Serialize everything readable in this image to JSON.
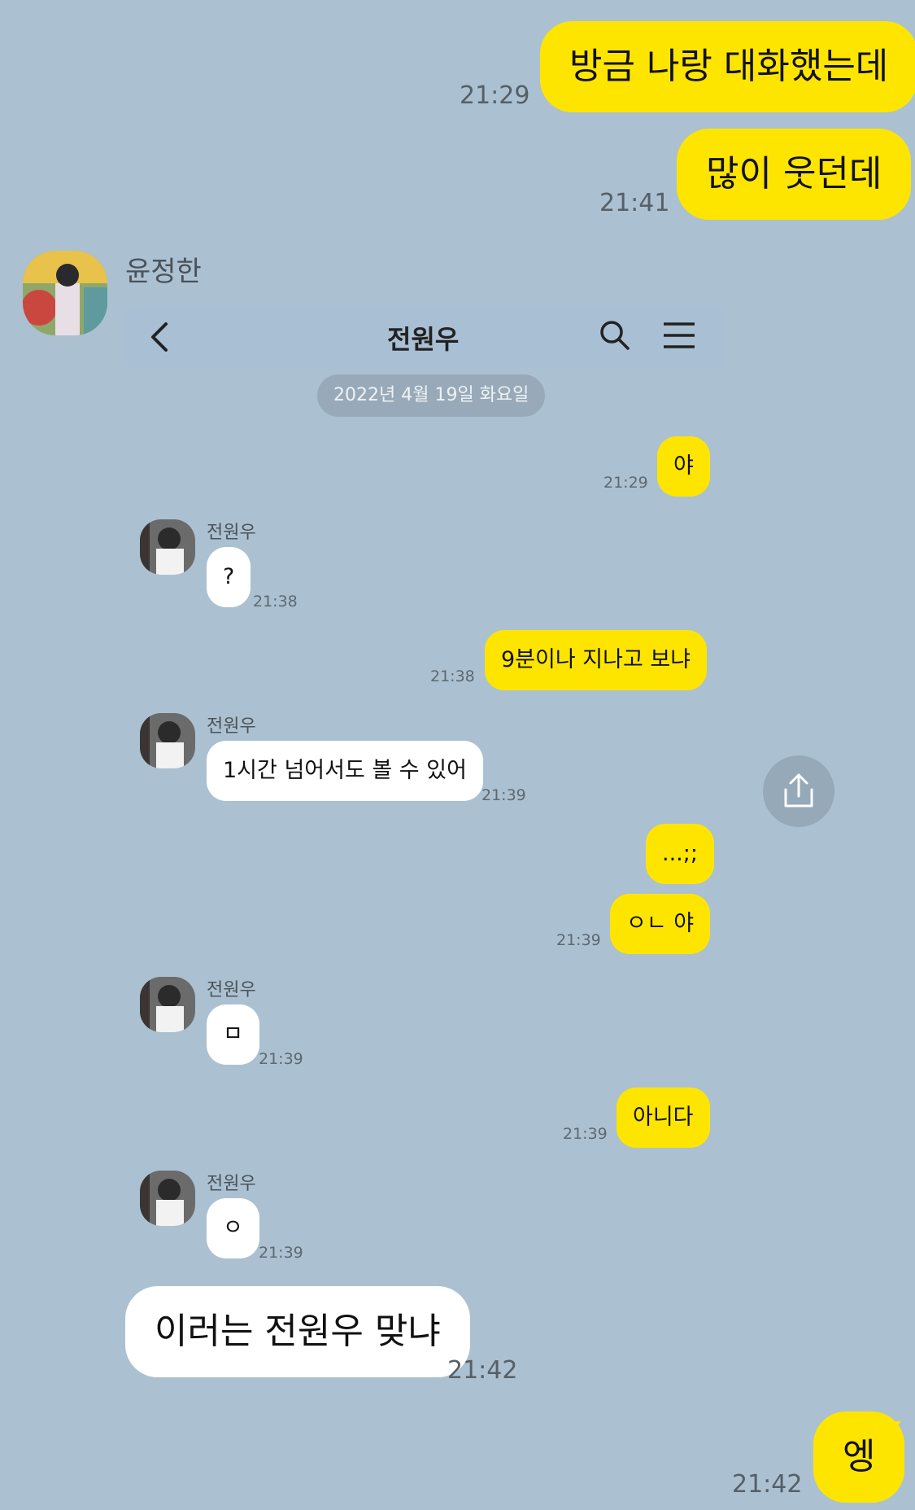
{
  "outer": {
    "msg1": {
      "text": "방금 나랑 대화했는데",
      "time": "21:29"
    },
    "msg2": {
      "text": "많이 웃던데",
      "time": "21:41"
    },
    "sender_name": "윤정한",
    "msg3": {
      "text": "이러는 전원우 맞냐",
      "time": "21:42"
    },
    "msg4": {
      "text": "엥",
      "time": "21:42"
    }
  },
  "embedded": {
    "title": "전원우",
    "date": "2022년 4월 19일 화요일",
    "contact_name": "전원우",
    "messages": [
      {
        "text": "야",
        "time": "21:29"
      },
      {
        "text": "?",
        "time": "21:38"
      },
      {
        "text": "9분이나 지나고 보냐",
        "time": "21:38"
      },
      {
        "text": "1시간 넘어서도 볼 수 있어",
        "time": "21:39"
      },
      {
        "text": "...;;",
        "time": ""
      },
      {
        "text": "ㅇㄴ 야",
        "time": "21:39"
      },
      {
        "text": "ㅁ",
        "time": "21:39"
      },
      {
        "text": "아니다",
        "time": "21:39"
      },
      {
        "text": "ㅇ",
        "time": "21:39"
      }
    ]
  },
  "colors": {
    "background": "#abc1d1",
    "my_bubble": "#fee500",
    "their_bubble": "#ffffff"
  },
  "icons": [
    "back-icon",
    "search-icon",
    "menu-icon",
    "share-icon"
  ]
}
